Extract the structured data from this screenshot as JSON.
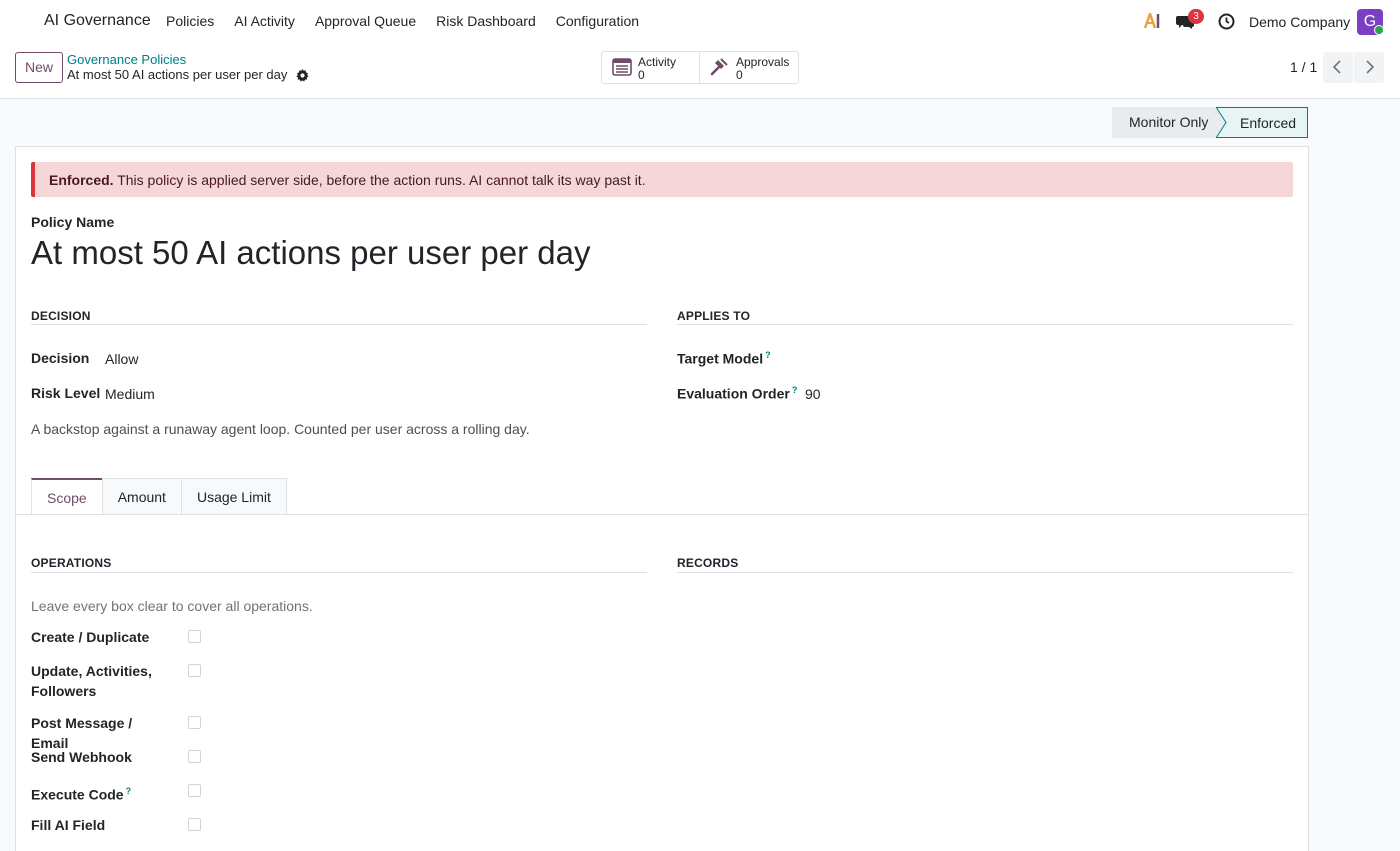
{
  "app": {
    "title": "AI Governance"
  },
  "menu": [
    "Policies",
    "AI Activity",
    "Approval Queue",
    "Risk Dashboard",
    "Configuration"
  ],
  "systray": {
    "chat_badge": "3",
    "company": "Demo Company",
    "avatar_initial": "G"
  },
  "control": {
    "new_label": "New",
    "breadcrumb_parent": "Governance Policies",
    "breadcrumb_current": "At most 50 AI actions per user per day",
    "smart_buttons": [
      {
        "label": "Activity",
        "value": "0",
        "icon": "list-icon"
      },
      {
        "label": "Approvals",
        "value": "0",
        "icon": "gavel-icon"
      }
    ],
    "pager": "1 / 1"
  },
  "status": {
    "stages": [
      "Monitor Only",
      "Enforced"
    ],
    "current": "Enforced"
  },
  "alert": {
    "bold": "Enforced.",
    "text": " This policy is applied server side, before the action runs. AI cannot talk its way past it."
  },
  "policy": {
    "label": "Policy Name",
    "name": "At most 50 AI actions per user per day"
  },
  "decision_section": {
    "title": "DECISION",
    "decision_label": "Decision",
    "decision_value": "Allow",
    "risk_label": "Risk Level",
    "risk_value": "Medium",
    "description": "A backstop against a runaway agent loop. Counted per user across a rolling day."
  },
  "applies_section": {
    "title": "APPLIES TO",
    "target_label": "Target Model",
    "target_value": "",
    "order_label": "Evaluation Order",
    "order_value": "90"
  },
  "tabs": [
    "Scope",
    "Amount",
    "Usage Limit"
  ],
  "scope": {
    "operations_title": "OPERATIONS",
    "records_title": "RECORDS",
    "hint": "Leave every box clear to cover all operations.",
    "operations": [
      {
        "label": "Create / Duplicate",
        "checked": false
      },
      {
        "label": "Update, Activities, Followers",
        "checked": false
      },
      {
        "label": "Post Message / Email",
        "checked": false
      },
      {
        "label": "Send Webhook",
        "checked": false
      },
      {
        "label": "Execute Code",
        "checked": false
      },
      {
        "label": "Fill AI Field",
        "checked": false
      }
    ]
  },
  "colors": {
    "brand": "#714b67",
    "teal": "#017e84",
    "alert_bg": "#f5d7da",
    "alert_border": "#d9363e"
  }
}
